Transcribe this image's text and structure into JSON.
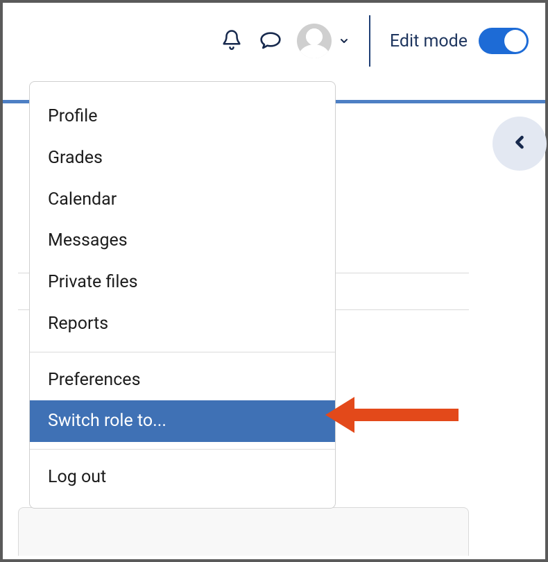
{
  "header": {
    "edit_mode_label": "Edit mode",
    "edit_mode_on": true
  },
  "menu": {
    "group1": [
      "Profile",
      "Grades",
      "Calendar",
      "Messages",
      "Private files",
      "Reports"
    ],
    "group2": [
      "Preferences",
      "Switch role to..."
    ],
    "group3": [
      "Log out"
    ],
    "highlighted": "Switch role to..."
  }
}
